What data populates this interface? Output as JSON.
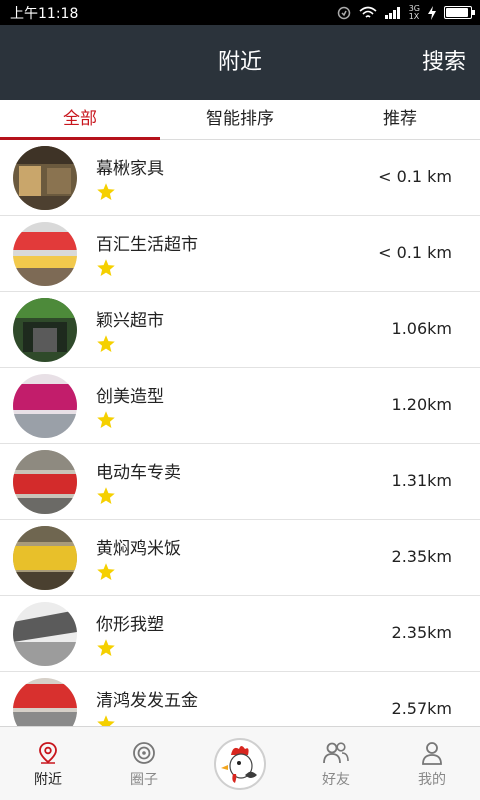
{
  "status_bar": {
    "time": "上午11:18",
    "network_top": "3G",
    "network_bottom": "1X"
  },
  "header": {
    "title": "附近",
    "search_label": "搜索"
  },
  "tabs": [
    {
      "label": "全部",
      "active": true
    },
    {
      "label": "智能排序",
      "active": false
    },
    {
      "label": "推荐",
      "active": false
    }
  ],
  "shops": [
    {
      "name": "幕楸家具",
      "distance": "< 0.1 km",
      "rating": 1
    },
    {
      "name": "百汇生活超市",
      "distance": "< 0.1 km",
      "rating": 1
    },
    {
      "name": "颖兴超市",
      "distance": "1.06km",
      "rating": 1
    },
    {
      "name": "创美造型",
      "distance": "1.20km",
      "rating": 1
    },
    {
      "name": "电动车专卖",
      "distance": "1.31km",
      "rating": 1
    },
    {
      "name": "黄焖鸡米饭",
      "distance": "2.35km",
      "rating": 1
    },
    {
      "name": "你形我塑",
      "distance": "2.35km",
      "rating": 1
    },
    {
      "name": "清鸿发发五金",
      "distance": "2.57km",
      "rating": 1
    }
  ],
  "bottom_nav": {
    "nearby": "附近",
    "circle": "圈子",
    "friends": "好友",
    "mine": "我的"
  },
  "colors": {
    "header_bg": "#2b333b",
    "accent": "#c8161d",
    "star": "#f5d000"
  }
}
